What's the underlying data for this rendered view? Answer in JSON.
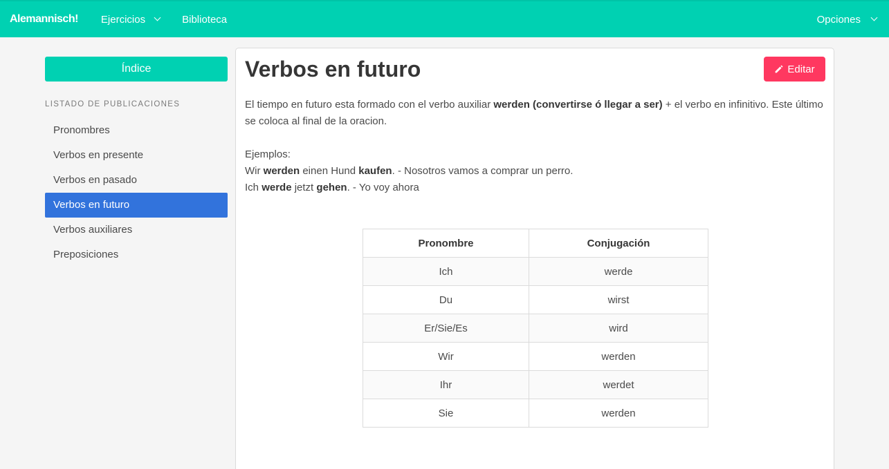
{
  "navbar": {
    "brand": "Alemannisch!",
    "items": [
      {
        "label": "Ejercicios",
        "dropdown": true
      },
      {
        "label": "Biblioteca",
        "dropdown": false
      }
    ],
    "right": {
      "label": "Opciones",
      "dropdown": true
    }
  },
  "sidebar": {
    "index_button": "Índice",
    "section_label": "LISTADO DE PUBLICACIONES",
    "items": [
      {
        "label": "Pronombres",
        "active": false
      },
      {
        "label": "Verbos en presente",
        "active": false
      },
      {
        "label": "Verbos en pasado",
        "active": false
      },
      {
        "label": "Verbos en futuro",
        "active": true
      },
      {
        "label": "Verbos auxiliares",
        "active": false
      },
      {
        "label": "Preposiciones",
        "active": false
      }
    ]
  },
  "main": {
    "title": "Verbos en futuro",
    "edit_button": "Editar",
    "intro": {
      "before": "El tiempo en futuro esta formado con el verbo auxiliar ",
      "bold": "werden (convertirse ó llegar a ser)",
      "after": " + el verbo en infinitivo. Este último se coloca al final de la oracion."
    },
    "examples_label": "Ejemplos:",
    "example1": {
      "p1": "Wir ",
      "b1": "werden",
      "p2": " einen Hund ",
      "b2": "kaufen",
      "p3": ". - Nosotros vamos a comprar un perro."
    },
    "example2": {
      "p1": "Ich ",
      "b1": "werde",
      "p2": " jetzt ",
      "b2": "gehen",
      "p3": ". - Yo voy ahora"
    },
    "table": {
      "headers": [
        "Pronombre",
        "Conjugación"
      ],
      "rows": [
        [
          "Ich",
          "werde"
        ],
        [
          "Du",
          "wirst"
        ],
        [
          "Er/Sie/Es",
          "wird"
        ],
        [
          "Wir",
          "werden"
        ],
        [
          "Ihr",
          "werdet"
        ],
        [
          "Sie",
          "werden"
        ]
      ]
    }
  },
  "colors": {
    "primary": "#00d1b2",
    "active": "#3273dc",
    "danger": "#ff3860"
  },
  "icons": {
    "edit": "pencil-icon",
    "dropdown": "chevron-down-icon"
  }
}
